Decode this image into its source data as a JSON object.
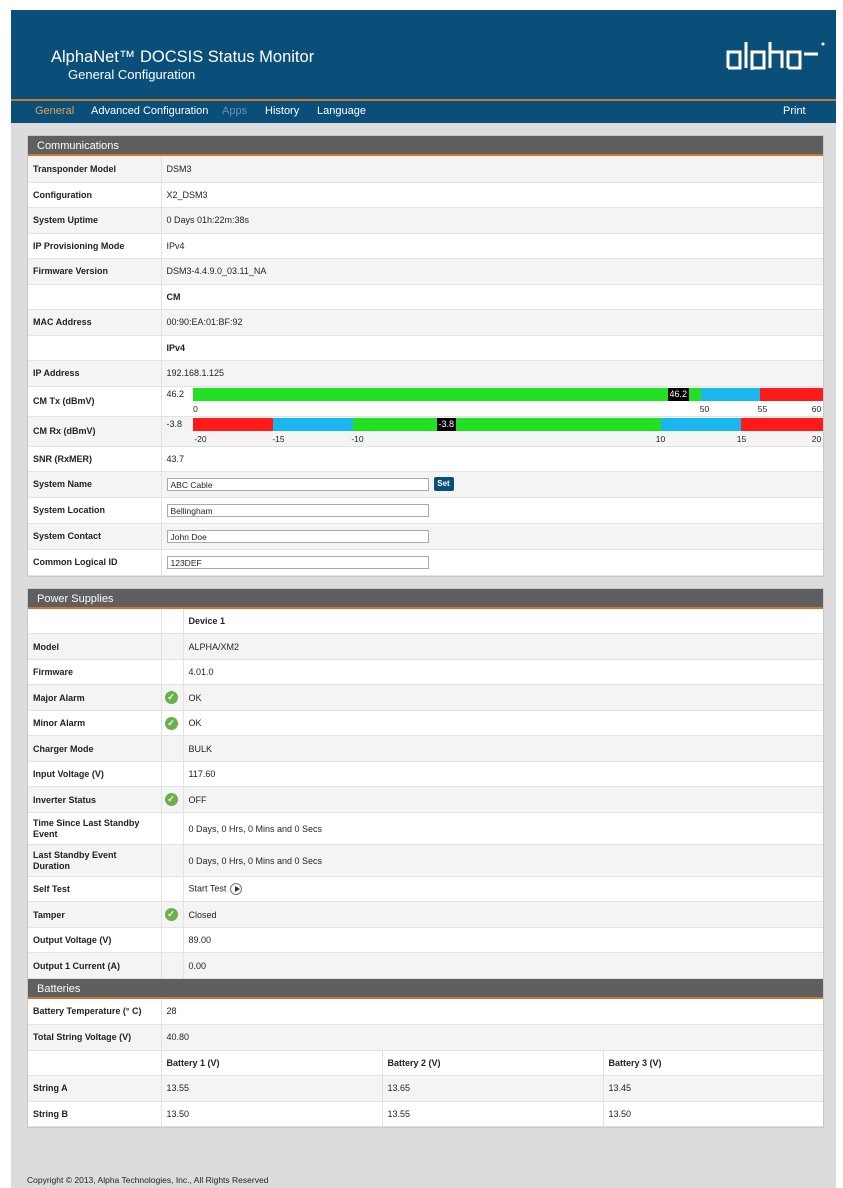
{
  "header": {
    "title": "AlphaNet™ DOCSIS Status Monitor",
    "subtitle": "General Configuration",
    "logo_text": "alpha"
  },
  "nav": {
    "general": "General",
    "advanced": "Advanced Configuration",
    "apps": "Apps",
    "history": "History",
    "language": "Language",
    "print": "Print"
  },
  "communications": {
    "title": "Communications",
    "transponder_model": {
      "label": "Transponder Model",
      "value": "DSM3"
    },
    "configuration": {
      "label": "Configuration",
      "value": "X2_DSM3"
    },
    "uptime": {
      "label": "System Uptime",
      "value": "0 Days 01h:22m:38s"
    },
    "ip_mode": {
      "label": "IP Provisioning Mode",
      "value": "IPv4"
    },
    "firmware": {
      "label": "Firmware Version",
      "value": "DSM3-4.4.9.0_03.11_NA"
    },
    "cm_heading": "CM",
    "mac": {
      "label": "MAC Address",
      "value": "00:90:EA:01:BF:92"
    },
    "ipv4_heading": "IPv4",
    "ip": {
      "label": "IP Address",
      "value": "192.168.1.125"
    },
    "cm_tx": {
      "label": "CM Tx (dBmV)",
      "value": "46.2",
      "marker": "46.2",
      "ticks": [
        "0",
        "50",
        "55",
        "60"
      ],
      "range": [
        0,
        60
      ],
      "reading": 46.2
    },
    "cm_rx": {
      "label": "CM Rx (dBmV)",
      "value": "-3.8",
      "marker": "-3.8",
      "ticks": [
        "-20",
        "-15",
        "-10",
        "10",
        "15",
        "20"
      ],
      "range": [
        -20,
        20
      ],
      "reading": -3.8
    },
    "snr": {
      "label": "SNR (RxMER)",
      "value": "43.7"
    },
    "system_name": {
      "label": "System Name",
      "value": "ABC Cable",
      "button": "Set"
    },
    "system_location": {
      "label": "System Location",
      "value": "Bellingham"
    },
    "system_contact": {
      "label": "System Contact",
      "value": "John Doe"
    },
    "logical_id": {
      "label": "Common Logical ID",
      "value": "123DEF"
    }
  },
  "power": {
    "title": "Power Supplies",
    "device_heading": "Device 1",
    "model": {
      "label": "Model",
      "value": "ALPHA/XM2"
    },
    "firmware": {
      "label": "Firmware",
      "value": "4.01.0"
    },
    "major_alarm": {
      "label": "Major Alarm",
      "value": "OK"
    },
    "minor_alarm": {
      "label": "Minor Alarm",
      "value": "OK"
    },
    "charger_mode": {
      "label": "Charger Mode",
      "value": "BULK"
    },
    "input_voltage": {
      "label": "Input Voltage (V)",
      "value": "117.60"
    },
    "inverter_status": {
      "label": "Inverter Status",
      "value": "OFF"
    },
    "time_since_standby": {
      "label": "Time Since Last Standby Event",
      "value": "0 Days, 0 Hrs, 0 Mins and 0 Secs"
    },
    "standby_duration": {
      "label": "Last Standby Event Duration",
      "value": "0 Days, 0 Hrs, 0 Mins and 0 Secs"
    },
    "self_test": {
      "label": "Self Test",
      "value": "Start Test"
    },
    "tamper": {
      "label": "Tamper",
      "value": "Closed"
    },
    "output_voltage": {
      "label": "Output Voltage (V)",
      "value": "89.00"
    },
    "output_current": {
      "label": "Output 1 Current (A)",
      "value": "0.00"
    }
  },
  "batteries": {
    "title": "Batteries",
    "temperature": {
      "label": "Battery Temperature (° C)",
      "value": "28"
    },
    "string_voltage": {
      "label": "Total String Voltage (V)",
      "value": "40.80"
    },
    "columns": [
      "Battery 1 (V)",
      "Battery 2 (V)",
      "Battery 3 (V)"
    ],
    "rows": [
      {
        "label": "String A",
        "values": [
          "13.55",
          "13.65",
          "13.45"
        ]
      },
      {
        "label": "String B",
        "values": [
          "13.50",
          "13.55",
          "13.50"
        ]
      }
    ]
  },
  "footer": {
    "copyright": "Copyright © 2013, Alpha Technologies, Inc., All Rights Reserved"
  },
  "colors": {
    "header_bg": "#0a4e7a",
    "accent": "#c87b2e",
    "good": "#22e022",
    "warn": "#18b8ee",
    "bad": "#ff1a1a"
  }
}
